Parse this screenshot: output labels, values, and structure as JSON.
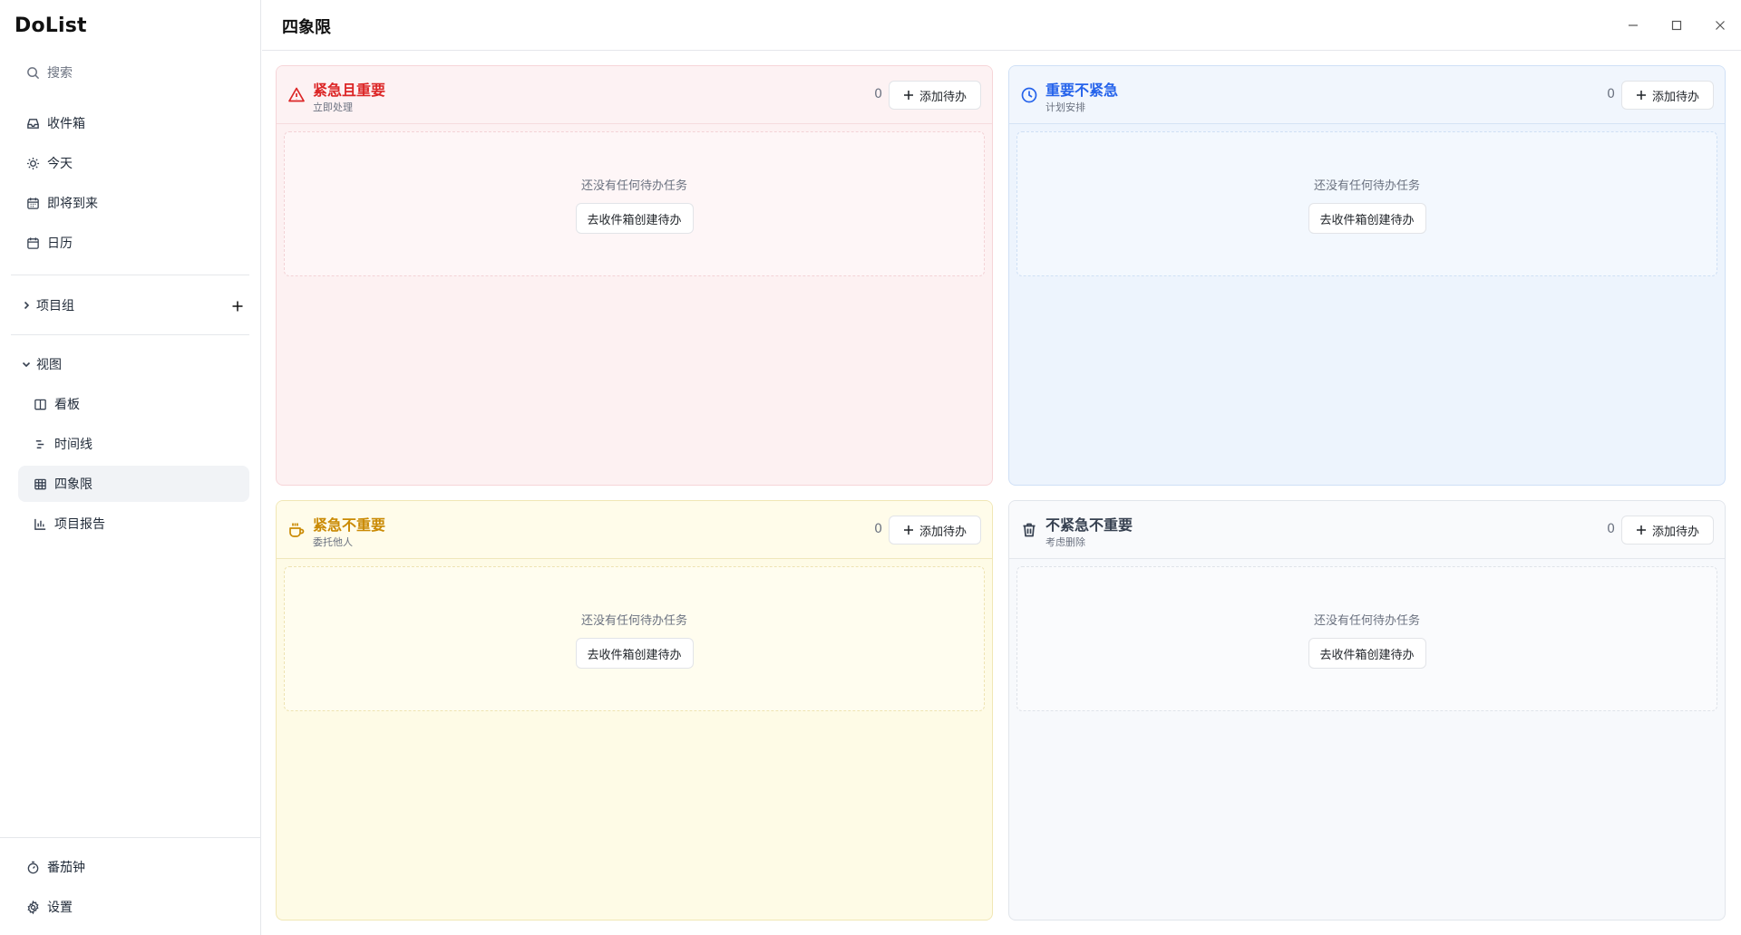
{
  "app": {
    "name": "DoList"
  },
  "sidebar": {
    "search_label": "搜索",
    "items": [
      {
        "label": "收件箱",
        "icon": "inbox-icon"
      },
      {
        "label": "今天",
        "icon": "sun-icon"
      },
      {
        "label": "即将到来",
        "icon": "calendar-icon"
      },
      {
        "label": "日历",
        "icon": "calendar-icon"
      }
    ],
    "project_group_label": "项目组",
    "views_label": "视图",
    "views": [
      {
        "label": "看板",
        "icon": "kanban-icon"
      },
      {
        "label": "时间线",
        "icon": "timeline-icon"
      },
      {
        "label": "四象限",
        "icon": "grid-icon",
        "active": true
      },
      {
        "label": "项目报告",
        "icon": "bar-chart-icon"
      }
    ],
    "bottom": [
      {
        "label": "番茄钟",
        "icon": "timer-icon"
      },
      {
        "label": "设置",
        "icon": "gear-icon"
      }
    ]
  },
  "header": {
    "title": "四象限"
  },
  "quadrants": [
    {
      "title": "紧急且重要",
      "subtitle": "立即处理",
      "count": "0",
      "add_label": "添加待办",
      "empty_text": "还没有任何待办任务",
      "empty_action": "去收件箱创建待办",
      "icon": "warning-triangle-icon",
      "color": "#dc2626"
    },
    {
      "title": "重要不紧急",
      "subtitle": "计划安排",
      "count": "0",
      "add_label": "添加待办",
      "empty_text": "还没有任何待办任务",
      "empty_action": "去收件箱创建待办",
      "icon": "clock-icon",
      "color": "#2563eb"
    },
    {
      "title": "紧急不重要",
      "subtitle": "委托他人",
      "count": "0",
      "add_label": "添加待办",
      "empty_text": "还没有任何待办任务",
      "empty_action": "去收件箱创建待办",
      "icon": "coffee-cup-icon",
      "color": "#ca8a04"
    },
    {
      "title": "不紧急不重要",
      "subtitle": "考虑删除",
      "count": "0",
      "add_label": "添加待办",
      "empty_text": "还没有任何待办任务",
      "empty_action": "去收件箱创建待办",
      "icon": "trash-icon",
      "color": "#374151"
    }
  ]
}
